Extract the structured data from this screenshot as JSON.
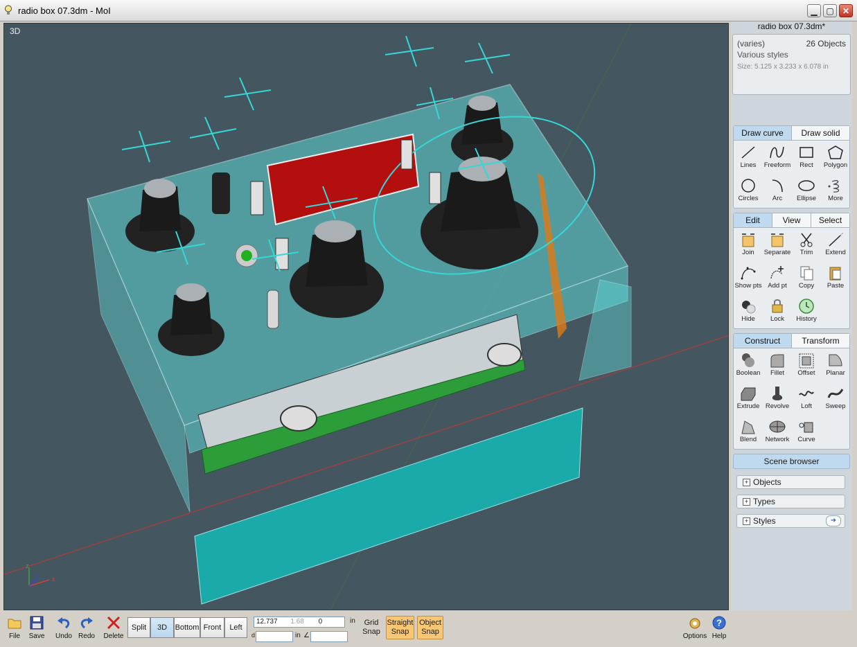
{
  "window": {
    "title": "radio box 07.3dm - MoI",
    "min_icon": "minimize-icon",
    "max_icon": "maximize-icon",
    "close_icon": "close-icon"
  },
  "viewport": {
    "label": "3D",
    "axes": {
      "x": "x",
      "y": "y",
      "z": "z"
    }
  },
  "panel": {
    "doc_name": "radio box 07.3dm*",
    "properties": {
      "name": "(varies)",
      "count": "26 Objects",
      "styles": "Various styles",
      "size": "Size: 5.125 x 3.233 x 6.078 in"
    },
    "draw_tabs": [
      "Draw curve",
      "Draw solid"
    ],
    "draw_tools": [
      {
        "label": "Lines",
        "icon": "lines-icon"
      },
      {
        "label": "Freeform",
        "icon": "freeform-icon"
      },
      {
        "label": "Rect",
        "icon": "rect-icon"
      },
      {
        "label": "Polygon",
        "icon": "polygon-icon"
      },
      {
        "label": "Circles",
        "icon": "circle-icon"
      },
      {
        "label": "Arc",
        "icon": "arc-icon"
      },
      {
        "label": "Ellipse",
        "icon": "ellipse-icon"
      },
      {
        "label": "More",
        "icon": "spiral-icon"
      }
    ],
    "edit_tabs": [
      "Edit",
      "View",
      "Select"
    ],
    "edit_tools": [
      {
        "label": "Join",
        "icon": "join-icon"
      },
      {
        "label": "Separate",
        "icon": "separate-icon"
      },
      {
        "label": "Trim",
        "icon": "scissors-icon"
      },
      {
        "label": "Extend",
        "icon": "extend-icon"
      },
      {
        "label": "Show pts",
        "icon": "show-points-icon"
      },
      {
        "label": "Add pt",
        "icon": "add-point-icon"
      },
      {
        "label": "Copy",
        "icon": "copy-icon"
      },
      {
        "label": "Paste",
        "icon": "paste-icon"
      },
      {
        "label": "Hide",
        "icon": "hide-icon"
      },
      {
        "label": "Lock",
        "icon": "lock-icon"
      },
      {
        "label": "History",
        "icon": "history-icon"
      }
    ],
    "construct_tabs": [
      "Construct",
      "Transform"
    ],
    "construct_tools": [
      {
        "label": "Boolean",
        "icon": "boolean-icon"
      },
      {
        "label": "Fillet",
        "icon": "fillet-icon"
      },
      {
        "label": "Offset",
        "icon": "offset-icon"
      },
      {
        "label": "Planar",
        "icon": "planar-icon"
      },
      {
        "label": "Extrude",
        "icon": "extrude-icon"
      },
      {
        "label": "Revolve",
        "icon": "revolve-icon"
      },
      {
        "label": "Loft",
        "icon": "loft-icon"
      },
      {
        "label": "Sweep",
        "icon": "sweep-icon"
      },
      {
        "label": "Blend",
        "icon": "blend-icon"
      },
      {
        "label": "Network",
        "icon": "network-icon"
      },
      {
        "label": "Curve",
        "icon": "curve-icon"
      }
    ],
    "scene_browser": "Scene browser",
    "scene_items": [
      "Objects",
      "Types",
      "Styles"
    ]
  },
  "bottom": {
    "file": "File",
    "save": "Save",
    "undo": "Undo",
    "redo": "Redo",
    "delete": "Delete",
    "views": [
      "Split",
      "3D",
      "Bottom",
      "Front",
      "Left"
    ],
    "active_view": "3D",
    "coords": {
      "x": "12.737",
      "y": "1.68",
      "z": "0",
      "unit": "in",
      "distance_label": "d",
      "distance_unit": "in",
      "angle_label": "∠",
      "distance_value": "",
      "angle_value": ""
    },
    "grid_snap": "Grid Snap",
    "straight_snap": "Straight Snap",
    "object_snap": "Object Snap",
    "options": "Options",
    "help": "Help"
  },
  "colors": {
    "viewport_bg": "#445761",
    "box_cyan": "#3fd3d1",
    "panel_active_tab": "#bfd9ee",
    "snap_active": "#f9c774"
  }
}
